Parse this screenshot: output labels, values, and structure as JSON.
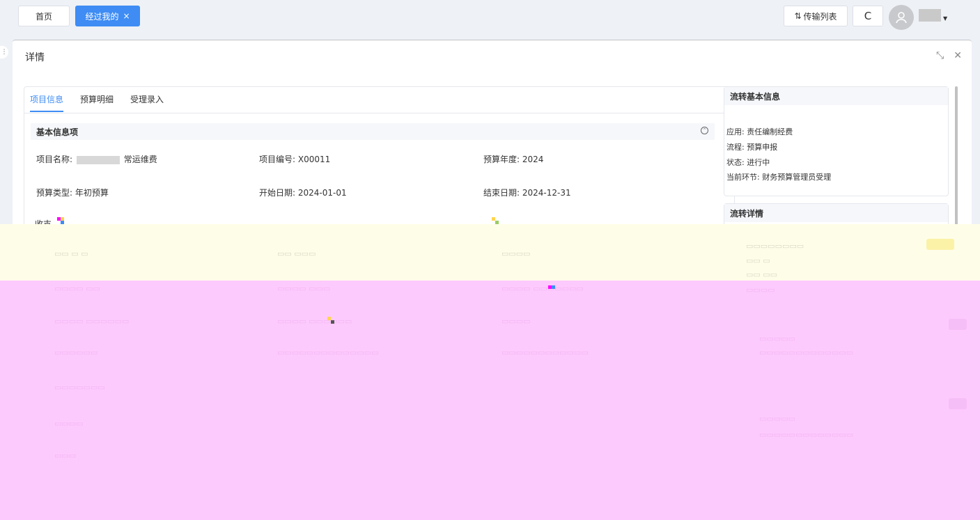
{
  "topbar": {
    "tabs": [
      {
        "label": "首页",
        "active": false
      },
      {
        "label": "经过我的",
        "active": true,
        "close": "×"
      }
    ],
    "transfer_label": "传输列表",
    "refresh_glyph": "C"
  },
  "panel": {
    "title": "详情",
    "tabs": [
      {
        "label": "项目信息",
        "active": true
      },
      {
        "label": "预算明细",
        "active": false
      },
      {
        "label": "受理录入",
        "active": false
      }
    ],
    "section_title": "基本信息项",
    "fields": {
      "project_name_label": "项目名称:",
      "project_name_suffix": "常运维费",
      "project_code": "项目编号: X00011",
      "budget_year": "预算年度: 2024",
      "budget_type": "预算类型: 年初预算",
      "start_date": "开始日期: 2024-01-01",
      "end_date": "结束日期: 2024-12-31",
      "partial_row_label": "收支"
    }
  },
  "flow_basic": {
    "title": "流转基本信息",
    "lines": [
      "应用: 责任编制经费",
      "流程: 预算申报",
      "状态: 进行中",
      "当前环节: 财务预算管理员受理"
    ]
  },
  "flow_detail": {
    "title": "流转详情"
  },
  "colors": {
    "accent": "#3e8cf4",
    "overlay_yellow": "#fefee8",
    "overlay_pink": "#fdcafd"
  }
}
